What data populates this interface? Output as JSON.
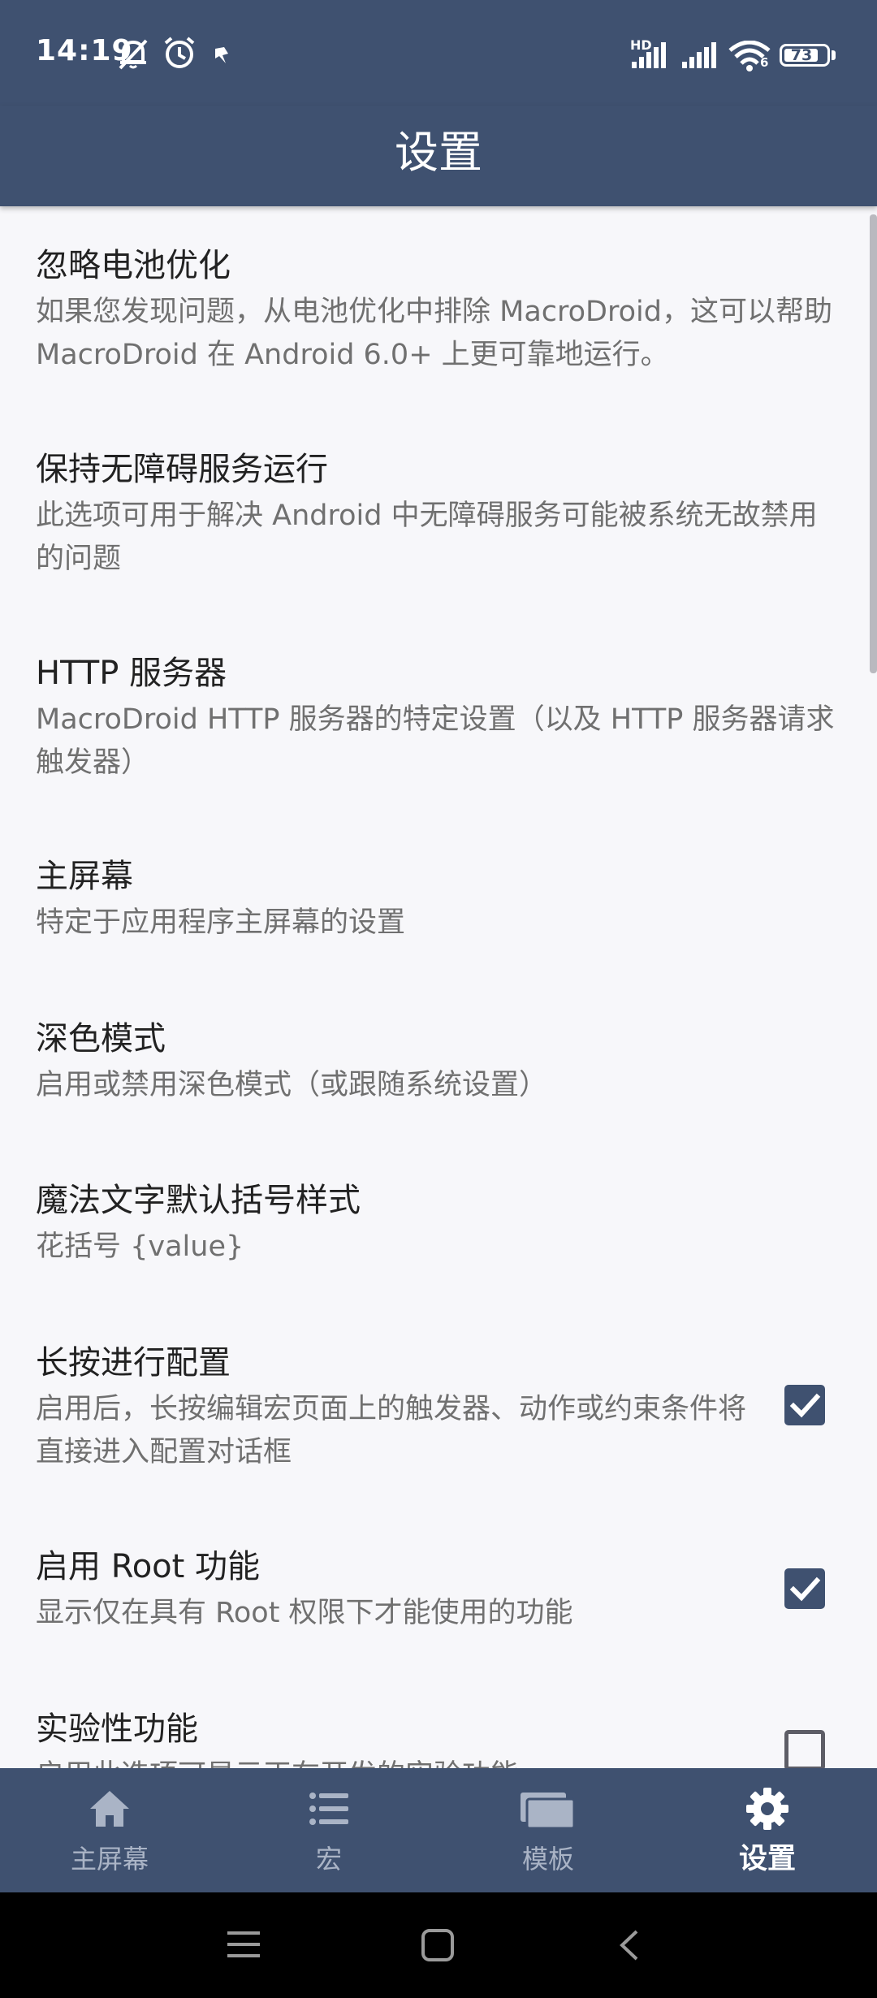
{
  "status_bar": {
    "time": "14:19",
    "battery": "73",
    "network_badge": "HD",
    "wifi_badge": "6",
    "icons": [
      "mute-icon",
      "alarm-icon",
      "app-notification-icon",
      "signal-icon",
      "wifi-icon",
      "battery-icon"
    ]
  },
  "app_bar": {
    "title": "设置"
  },
  "settings": [
    {
      "title": "忽略电池优化",
      "description": "如果您发现问题，从电池优化中排除 MacroDroid，这可以帮助 MacroDroid 在 Android 6.0+ 上更可靠地运行。"
    },
    {
      "title": "保持无障碍服务运行",
      "description": "此选项可用于解决 Android 中无障碍服务可能被系统无故禁用的问题"
    },
    {
      "title": "HTTP 服务器",
      "description": "MacroDroid HTTP 服务器的特定设置（以及 HTTP 服务器请求触发器）"
    },
    {
      "title": "主屏幕",
      "description": "特定于应用程序主屏幕的设置"
    },
    {
      "title": "深色模式",
      "description": "启用或禁用深色模式（或跟随系统设置）"
    },
    {
      "title": "魔法文字默认括号样式",
      "description": "花括号 {value}"
    },
    {
      "title": "长按进行配置",
      "description": "启用后，长按编辑宏页面上的触发器、动作或约束条件将直接进入配置对话框",
      "checked": true
    },
    {
      "title": "启用 Root 功能",
      "description": "显示仅在具有 Root 权限下才能使用的功能",
      "checked": true
    },
    {
      "title": "实验性功能",
      "description": "启用此选项可显示正在开发的实验功能",
      "checked": false
    }
  ],
  "bottom_nav": [
    {
      "label": "主屏幕",
      "icon": "home-icon",
      "active": false
    },
    {
      "label": "宏",
      "icon": "list-icon",
      "active": false
    },
    {
      "label": "模板",
      "icon": "templates-icon",
      "active": false
    },
    {
      "label": "设置",
      "icon": "gear-icon",
      "active": true
    }
  ],
  "system_nav": {
    "icons": [
      "menu-icon",
      "home-square-icon",
      "back-icon"
    ]
  },
  "colors": {
    "primary": "#3f5170",
    "background": "#f7f7fa",
    "title_text": "#222222",
    "description_text": "#707070",
    "nav_inactive": "#aab4c6",
    "nav_active": "#ffffff"
  }
}
